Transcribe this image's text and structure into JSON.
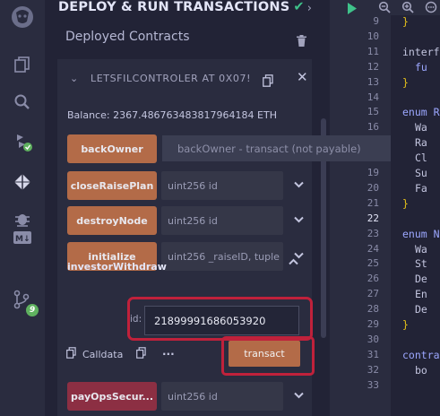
{
  "panel": {
    "title": "DEPLOY & RUN TRANSACTIONS",
    "title_check": "✔",
    "title_chevron": "›",
    "deployed_label": "Deployed Contracts"
  },
  "instance": {
    "chevron": "⌄",
    "name": "LETSFILCONTROLER AT 0X07!",
    "close": "✕",
    "balance": "Balance: 2367.486763483817964184 ETH"
  },
  "functions": [
    {
      "label": "backOwner",
      "placeholder": "",
      "color": "orange"
    },
    {
      "label": "closeRaisePlan",
      "placeholder": "uint256 id",
      "color": "orange"
    },
    {
      "label": "destroyNode",
      "placeholder": "uint256 id",
      "color": "orange"
    },
    {
      "label": "initialize",
      "placeholder": "uint256 _raiseID, tuple",
      "color": "orange"
    }
  ],
  "tooltip": "backOwner - transact (not payable)",
  "expanded_function": {
    "name": "investorWithdraw",
    "chevron": "⌃",
    "param_label": "id:",
    "param_value": "21899991686053920",
    "calldata_label": "Calldata",
    "parameters_dots": "...",
    "transact_label": "transact"
  },
  "last_function": {
    "label": "payOpsSecur...",
    "placeholder": "uint256 id",
    "color": "red"
  },
  "sidebar": {
    "badge_count": "9"
  },
  "editor": {
    "line_numbers": [
      "9",
      "10",
      "11",
      "12",
      "13",
      "14",
      "15",
      "16",
      "17",
      "18",
      "19",
      "20",
      "21",
      "22",
      "23",
      "24",
      "25",
      "26",
      "27",
      "28",
      "29",
      "30",
      "31",
      "32",
      "33"
    ],
    "current_line": "22",
    "lines": [
      {
        "n": "9",
        "text": "}",
        "cls": "br",
        "indent": 0
      },
      {
        "n": "11",
        "text": "interf",
        "cls": "pl",
        "indent": 0
      },
      {
        "n": "12",
        "text": "fu",
        "cls": "kw",
        "indent": 2
      },
      {
        "n": "13",
        "text": "}",
        "cls": "br",
        "indent": 0
      },
      {
        "n": "15",
        "text": "enum R",
        "cls": "kw",
        "indent": 0
      },
      {
        "n": "16",
        "text": "Wa",
        "cls": "pl",
        "indent": 2
      },
      {
        "n": "17",
        "text": "Ra",
        "cls": "pl",
        "indent": 2
      },
      {
        "n": "18",
        "text": "Cl",
        "cls": "pl",
        "indent": 2
      },
      {
        "n": "19",
        "text": "Su",
        "cls": "pl",
        "indent": 2
      },
      {
        "n": "20",
        "text": "Fa",
        "cls": "pl",
        "indent": 2
      },
      {
        "n": "21",
        "text": "}",
        "cls": "br",
        "indent": 0
      },
      {
        "n": "23",
        "text": "enum N",
        "cls": "kw",
        "indent": 0
      },
      {
        "n": "24",
        "text": "Wa",
        "cls": "pl",
        "indent": 2
      },
      {
        "n": "25",
        "text": "St",
        "cls": "pl",
        "indent": 2
      },
      {
        "n": "26",
        "text": "De",
        "cls": "pl",
        "indent": 2
      },
      {
        "n": "27",
        "text": "En",
        "cls": "pl",
        "indent": 2
      },
      {
        "n": "28",
        "text": "De",
        "cls": "pl",
        "indent": 2
      },
      {
        "n": "29",
        "text": "}",
        "cls": "br",
        "indent": 0
      },
      {
        "n": "31",
        "text": "contra",
        "cls": "kw",
        "indent": 0
      },
      {
        "n": "32",
        "text": "bo",
        "cls": "pl",
        "indent": 2
      }
    ]
  },
  "colors": {
    "orange_button": "#b36b48",
    "red_button": "#8c2f43",
    "highlight": "#c0213b",
    "check": "#3fc28a"
  }
}
